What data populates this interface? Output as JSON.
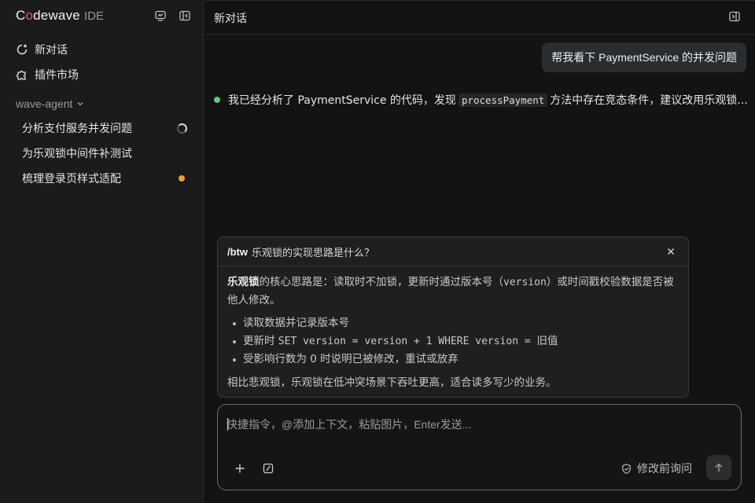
{
  "brand": {
    "name_pre": "C",
    "name_o": "o",
    "name_post": "dewave",
    "suffix": "IDE"
  },
  "sidebar": {
    "top_icons": [
      "chat-history-icon",
      "collapse-sidebar-icon"
    ],
    "nav": [
      {
        "label": "新对话",
        "icon": "new-chat-icon"
      },
      {
        "label": "插件市场",
        "icon": "puzzle-icon"
      }
    ],
    "section": {
      "label": "wave-agent",
      "icon": "chevron-down-icon"
    },
    "conversations": [
      {
        "label": "分析支付服务并发问题",
        "status": "running"
      },
      {
        "label": "为乐观锁中间件补测试",
        "status": ""
      },
      {
        "label": "梳理登录页样式适配",
        "status": "unread"
      }
    ],
    "status_colors": {
      "running": "#d8d8d8",
      "unread": "#e8a33c"
    }
  },
  "header": {
    "title": "新对话",
    "panel_icon": "toggle-panel-icon"
  },
  "chat": {
    "user_message": "帮我看下 PaymentService 的并发问题",
    "assistant": {
      "status_color": "#5fc47f",
      "text_before": "我已经分析了 PaymentService 的代码，发现",
      "code": "processPayment",
      "text_after": "方法中存在竞态条件，建议改用乐观锁..."
    }
  },
  "btw": {
    "command": "/btw",
    "question": "乐观锁的实现思路是什么？",
    "intro_bold": "乐观锁",
    "intro_text_1": "的核心思路是：读取时不加锁，更新时通过版本号（",
    "intro_code": "version",
    "intro_text_2": "）或时间戳校验数据是否被他人修改。",
    "steps": [
      {
        "text": "读取数据并记录版本号",
        "code": ""
      },
      {
        "text": "更新时 ",
        "code": "SET version = version + 1 WHERE version = ",
        "tail": "旧值"
      },
      {
        "text": "受影响行数为 0 时说明已被修改，重试或放弃",
        "code": ""
      }
    ],
    "footer": "相比悲观锁，乐观锁在低冲突场景下吞吐更高，适合读多写少的业务。"
  },
  "composer": {
    "placeholder": "快捷指令，@添加上下文，粘贴图片，Enter发送...",
    "value": "",
    "mode_label": "修改前询问",
    "mode_icon": "shield-check-icon",
    "attach_icon": "plus-icon",
    "command_icon": "slash-command-icon",
    "send_icon": "arrow-up-icon"
  }
}
